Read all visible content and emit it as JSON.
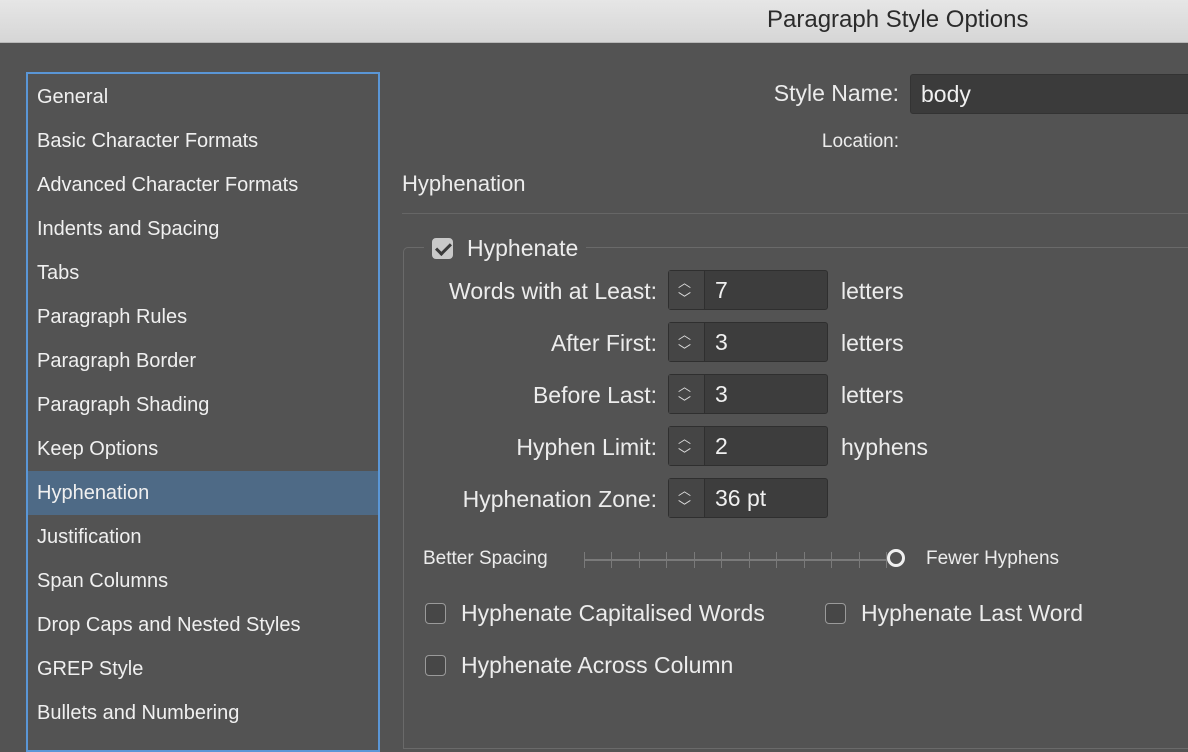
{
  "window": {
    "title": "Paragraph Style Options"
  },
  "sidebar": {
    "items": [
      {
        "label": "General",
        "selected": false
      },
      {
        "label": "Basic Character Formats",
        "selected": false
      },
      {
        "label": "Advanced Character Formats",
        "selected": false
      },
      {
        "label": "Indents and Spacing",
        "selected": false
      },
      {
        "label": "Tabs",
        "selected": false
      },
      {
        "label": "Paragraph Rules",
        "selected": false
      },
      {
        "label": "Paragraph Border",
        "selected": false
      },
      {
        "label": "Paragraph Shading",
        "selected": false
      },
      {
        "label": "Keep Options",
        "selected": false
      },
      {
        "label": "Hyphenation",
        "selected": true
      },
      {
        "label": "Justification",
        "selected": false
      },
      {
        "label": "Span Columns",
        "selected": false
      },
      {
        "label": "Drop Caps and Nested Styles",
        "selected": false
      },
      {
        "label": "GREP Style",
        "selected": false
      },
      {
        "label": "Bullets and Numbering",
        "selected": false
      }
    ]
  },
  "header": {
    "style_name_label": "Style Name:",
    "style_name_value": "body",
    "location_label": "Location:"
  },
  "section": {
    "title": "Hyphenation",
    "hyphenate": {
      "label": "Hyphenate",
      "checked": true
    },
    "fields": [
      {
        "label": "Words with at Least:",
        "value": "7",
        "unit": "letters"
      },
      {
        "label": "After First:",
        "value": "3",
        "unit": "letters"
      },
      {
        "label": "Before Last:",
        "value": "3",
        "unit": "letters"
      },
      {
        "label": "Hyphen Limit:",
        "value": "2",
        "unit": "hyphens"
      },
      {
        "label": "Hyphenation Zone:",
        "value": "36 pt",
        "unit": ""
      }
    ],
    "slider": {
      "left_label": "Better Spacing",
      "right_label": "Fewer Hyphens",
      "position_fraction": 1.0,
      "tick_count": 12
    },
    "options": {
      "capitalised": {
        "label": "Hyphenate Capitalised Words",
        "checked": false
      },
      "last_word": {
        "label": "Hyphenate Last Word",
        "checked": false
      },
      "across_column": {
        "label": "Hyphenate Across Column",
        "checked": false
      }
    }
  },
  "colors": {
    "panel_bg": "#535353",
    "selection_bg": "#4e6a86",
    "focus_border": "#5a96d6"
  }
}
